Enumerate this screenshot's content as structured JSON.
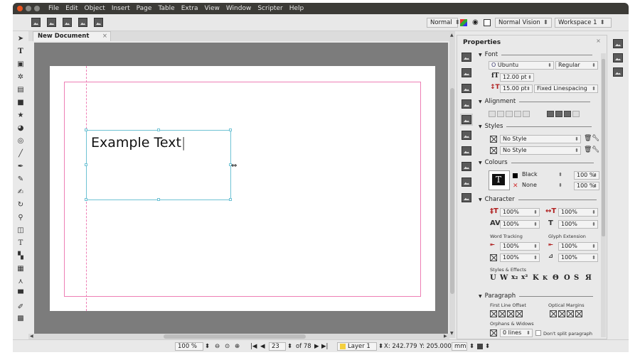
{
  "menubar": {
    "items": [
      "File",
      "Edit",
      "Object",
      "Insert",
      "Page",
      "Table",
      "Extra",
      "View",
      "Window",
      "Scripter",
      "Help"
    ]
  },
  "toolbar": {
    "icons": [
      "image-icon",
      "image-icon",
      "image-icon",
      "image-icon",
      "image-icon"
    ],
    "preview_mode": "Normal",
    "vision": "Normal Vision",
    "workspace": "Workspace 1"
  },
  "tools": [
    "select-arrow-icon",
    "text-tool-icon",
    "image-frame-icon",
    "render-frame-icon",
    "table-icon",
    "shape-icon",
    "polygon-icon",
    "arc-icon",
    "spiral-icon",
    "line-icon",
    "bezier-icon",
    "freehand-icon",
    "calligraphic-icon",
    "rotate-icon",
    "zoom-icon",
    "edit-content-icon",
    "edit-text-icon",
    "link-frames-icon",
    "unlink-frames-icon",
    "measure-icon",
    "copy-properties-icon",
    "eyedropper-icon",
    "pdf-icon"
  ],
  "document": {
    "tab_title": "New Document",
    "tab_close": "×",
    "frame_text": "Example Text"
  },
  "statusbar": {
    "zoom": "100 %",
    "page_current": "23",
    "page_total": "of 78",
    "layer": "Layer 1",
    "x_coord": "X: 242.779",
    "y_coord": "Y: 205.000",
    "unit": "mm"
  },
  "properties": {
    "title": "Properties",
    "close": "×",
    "font_section": "Font",
    "font_family": "Ubuntu",
    "font_style": "Regular",
    "font_size": "12.00 pt",
    "line_spacing": "15.00 pt",
    "line_spacing_mode": "Fixed Linespacing",
    "alignment_section": "Alignment",
    "styles_section": "Styles",
    "para_style": "No Style",
    "char_style": "No Style",
    "colours_section": "Colours",
    "text_color": "Black",
    "stroke_color": "None",
    "text_shade": "100 %",
    "stroke_shade": "100 %",
    "character_section": "Character",
    "scale_v": "100%",
    "scale_h": "100%",
    "kerning": "100%",
    "baseline": "100%",
    "word_tracking_label": "Word Tracking",
    "glyph_extension_label": "Glyph Extension",
    "word_tracking_min": "100%",
    "glyph_min": "100%",
    "word_tracking_norm": "100%",
    "glyph_max": "100%",
    "styles_effects_label": "Styles & Effects",
    "paragraph_section": "Paragraph",
    "first_line_label": "First Line Offset",
    "optical_margins_label": "Optical Margins",
    "orphans_label": "Orphans & Widows",
    "orphans_value": "0 lines",
    "dont_split_label": "Don't split paragraph"
  },
  "colors": {
    "menubar_bg": "#3c3b37",
    "close_button": "#e9541f",
    "margin_guide": "#ee7fb5",
    "frame_border": "#6fc2d4",
    "canvas_bg": "#7c7c7c"
  }
}
